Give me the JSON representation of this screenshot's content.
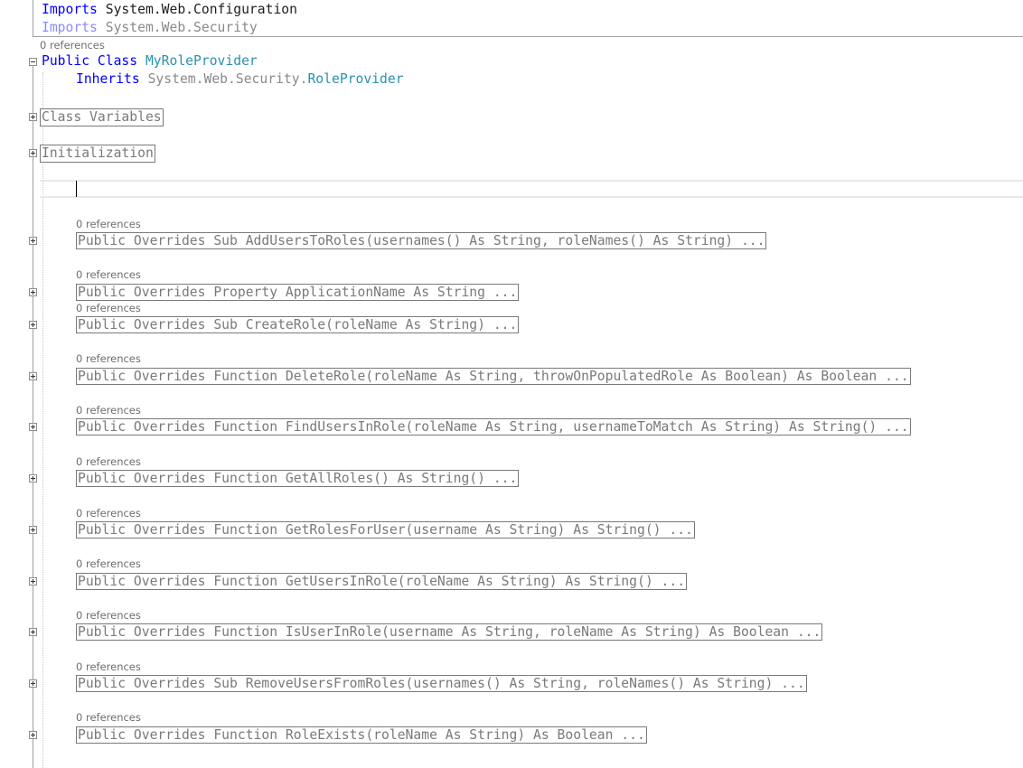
{
  "imports": [
    {
      "keyword": "Imports",
      "namespace": "System.Web.Configuration",
      "dimmed": false
    },
    {
      "keyword": "Imports",
      "namespace": "System.Web.Security",
      "dimmed": true
    }
  ],
  "class_decl": {
    "codelens": "0 references",
    "keyword": "Public Class",
    "name": "MyRoleProvider",
    "inherits_keyword": "Inherits",
    "inherits_namespace": "System.Web.Security.",
    "inherits_type": "RoleProvider"
  },
  "regions": [
    {
      "label": "Class Variables"
    },
    {
      "label": "Initialization"
    }
  ],
  "members": [
    {
      "codelens": "0 references",
      "signature": "Public Overrides Sub AddUsersToRoles(usernames() As String, roleNames() As String) ..."
    },
    {
      "codelens": "0 references",
      "signature": "Public Overrides Property ApplicationName As String ..."
    },
    {
      "codelens": "0 references",
      "signature": "Public Overrides Sub CreateRole(roleName As String) ..."
    },
    {
      "codelens": "0 references",
      "signature": "Public Overrides Function DeleteRole(roleName As String, throwOnPopulatedRole As Boolean) As Boolean ..."
    },
    {
      "codelens": "0 references",
      "signature": "Public Overrides Function FindUsersInRole(roleName As String, usernameToMatch As String) As String() ..."
    },
    {
      "codelens": "0 references",
      "signature": "Public Overrides Function GetAllRoles() As String() ..."
    },
    {
      "codelens": "0 references",
      "signature": "Public Overrides Function GetRolesForUser(username As String) As String() ..."
    },
    {
      "codelens": "0 references",
      "signature": "Public Overrides Function GetUsersInRole(roleName As String) As String() ..."
    },
    {
      "codelens": "0 references",
      "signature": "Public Overrides Function IsUserInRole(username As String, roleName As String) As Boolean ..."
    },
    {
      "codelens": "0 references",
      "signature": "Public Overrides Sub RemoveUsersFromRoles(usernames() As String, roleNames() As String) ..."
    },
    {
      "codelens": "0 references",
      "signature": "Public Overrides Function RoleExists(roleName As String) As Boolean ..."
    }
  ],
  "colors": {
    "keyword": "#0000ff",
    "type": "#2b91af",
    "collapsed_text": "#7a7a7a",
    "codelens": "#6e6e6e"
  }
}
